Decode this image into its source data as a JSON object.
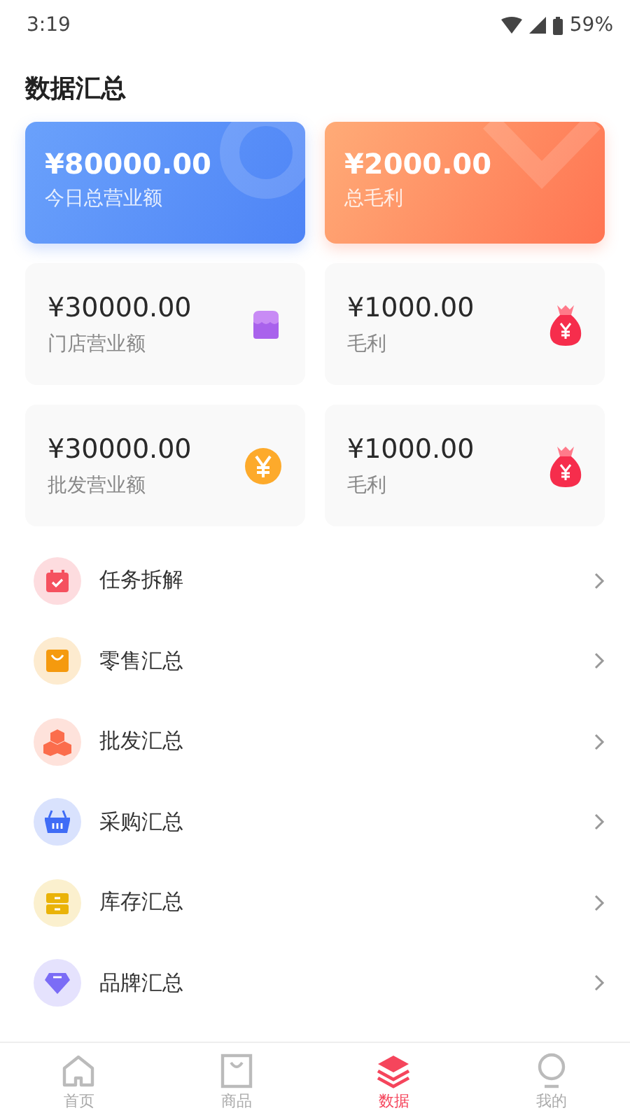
{
  "status_bar": {
    "time": "3:19",
    "battery": "59%"
  },
  "title": "数据汇总",
  "highlights": [
    {
      "kind": "blue",
      "amount": "¥80000.00",
      "label": "今日总营业额"
    },
    {
      "kind": "orange",
      "amount": "¥2000.00",
      "label": "总毛利"
    }
  ],
  "stats": [
    {
      "kind": "store",
      "amount": "¥30000.00",
      "label": "门店营业额"
    },
    {
      "kind": "moneybag",
      "amount": "¥1000.00",
      "label": "毛利"
    },
    {
      "kind": "coin",
      "amount": "¥30000.00",
      "label": "批发营业额"
    },
    {
      "kind": "moneybag",
      "amount": "¥1000.00",
      "label": "毛利"
    }
  ],
  "menu": [
    {
      "kind": "calendar",
      "label": "任务拆解",
      "color": "#f5515f"
    },
    {
      "kind": "bag",
      "label": "零售汇总",
      "color": "#f59a0e"
    },
    {
      "kind": "boxes",
      "label": "批发汇总",
      "color": "#fb6d4c"
    },
    {
      "kind": "basket",
      "label": "采购汇总",
      "color": "#3f6cf6"
    },
    {
      "kind": "drawer",
      "label": "库存汇总",
      "color": "#eab308"
    },
    {
      "kind": "gem",
      "label": "品牌汇总",
      "color": "#7b6cf6"
    }
  ],
  "nav": [
    {
      "kind": "home",
      "label": "首页",
      "selected": false
    },
    {
      "kind": "goods",
      "label": "商品",
      "selected": false
    },
    {
      "kind": "data",
      "label": "数据",
      "selected": true
    },
    {
      "kind": "me",
      "label": "我的",
      "selected": false
    }
  ]
}
